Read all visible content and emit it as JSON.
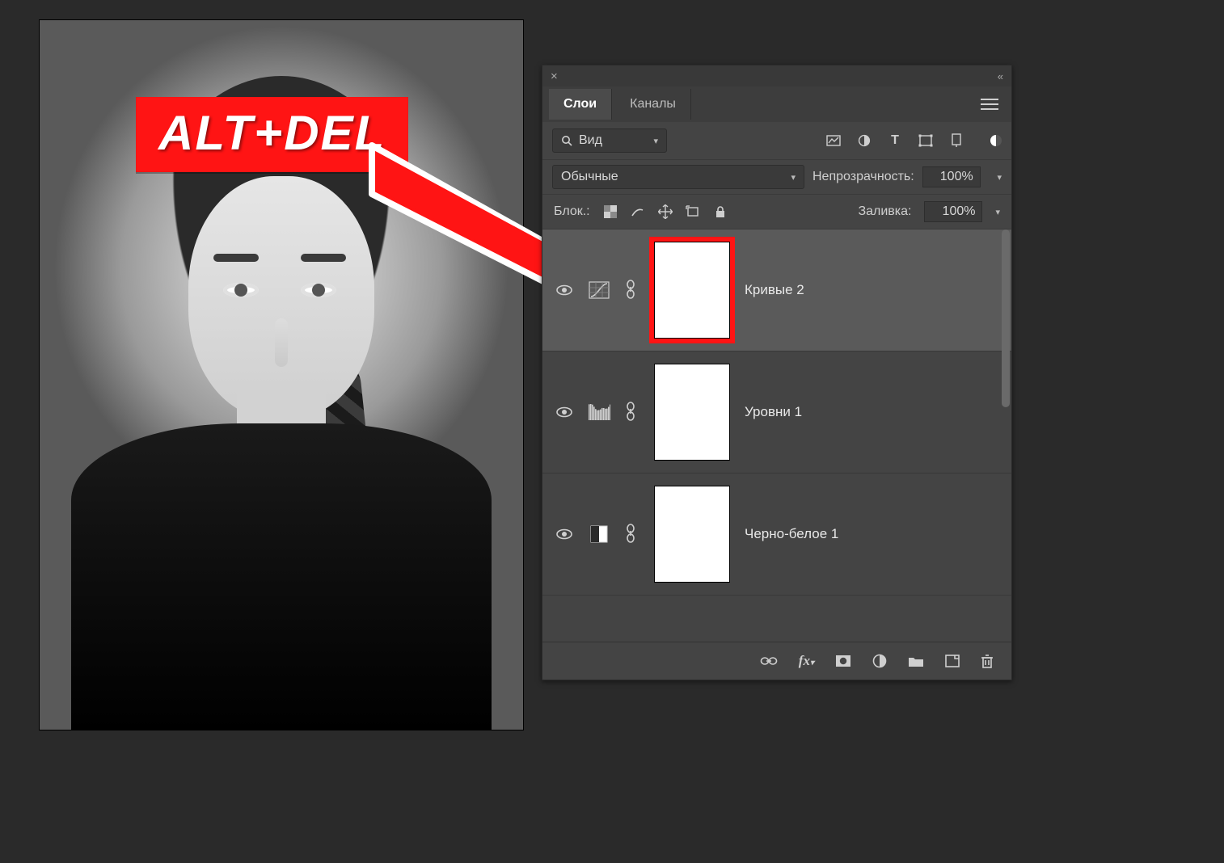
{
  "badge": {
    "text": "ALT+DEL"
  },
  "panel": {
    "tabs": {
      "layers": "Слои",
      "channels": "Каналы"
    },
    "search": {
      "label": "Вид"
    },
    "blend": {
      "mode": "Обычные",
      "opacity_label": "Непрозрачность:",
      "opacity_value": "100%"
    },
    "lock": {
      "label": "Блок.:",
      "fill_label": "Заливка:",
      "fill_value": "100%"
    },
    "layers": [
      {
        "name": "Кривые 2",
        "adj": "curves",
        "selected": true,
        "highlight_mask": true
      },
      {
        "name": "Уровни 1",
        "adj": "levels",
        "selected": false,
        "highlight_mask": false
      },
      {
        "name": "Черно-белое 1",
        "adj": "bw",
        "selected": false,
        "highlight_mask": false
      }
    ],
    "footer_icons": [
      "link",
      "fx",
      "mask",
      "adjust",
      "group",
      "new",
      "trash"
    ]
  },
  "colors": {
    "accent": "#ff1414",
    "panel": "#444",
    "highlight": "#ff1414"
  }
}
